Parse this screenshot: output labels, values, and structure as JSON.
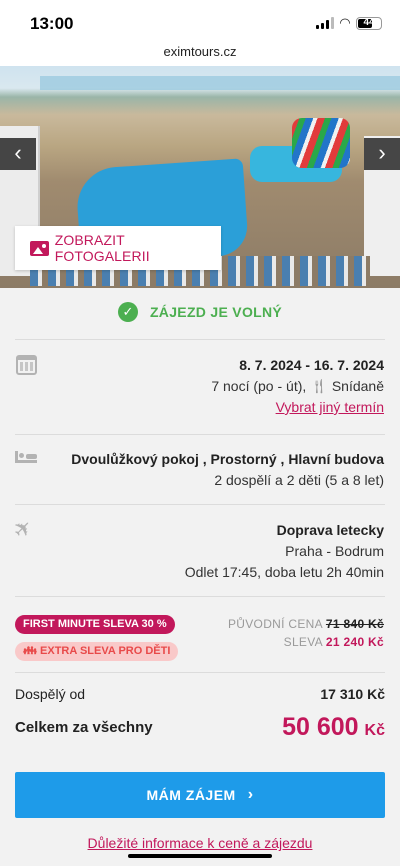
{
  "status_bar": {
    "time": "13:00",
    "battery": "44"
  },
  "browser": {
    "url": "eximtours.cz"
  },
  "hero": {
    "gallery_label": "ZOBRAZIT FOTOGALERII",
    "prev_icon": "chevron-left-icon",
    "next_icon": "chevron-right-icon"
  },
  "availability": {
    "label": "ZÁJEZD JE VOLNÝ",
    "color": "#4caf50"
  },
  "term": {
    "dates": "8. 7. 2024 - 16. 7. 2024",
    "nights": "7 nocí (po - út),",
    "meal": "Snídaně",
    "change_link": "Vybrat jiný termín"
  },
  "room": {
    "type": "Dvoulůžkový pokoj , Prostorný , Hlavní budova",
    "occupancy": "2 dospělí a 2 děti (5 a 8 let)"
  },
  "transport": {
    "type": "Doprava letecky",
    "route": "Praha - Bodrum",
    "departure": "Odlet 17:45, doba letu 2h 40min"
  },
  "discounts": {
    "first_minute": "FIRST MINUTE SLEVA 30 %",
    "extra": "EXTRA SLEVA PRO DĚTI",
    "original_label": "PŮVODNÍ CENA",
    "original_value": "71 840 Kč",
    "discount_label": "SLEVA",
    "discount_value": "21 240 Kč"
  },
  "pricing": {
    "adult_label": "Dospělý od",
    "adult_value": "17 310 Kč",
    "total_label": "Celkem za všechny",
    "total_value": "50 600",
    "currency": "Kč"
  },
  "actions": {
    "cta": "MÁM ZÁJEM",
    "info_link": "Důležité informace k ceně a zájezdu"
  },
  "colors": {
    "brand": "#c2185b",
    "cta": "#1e9be9"
  }
}
